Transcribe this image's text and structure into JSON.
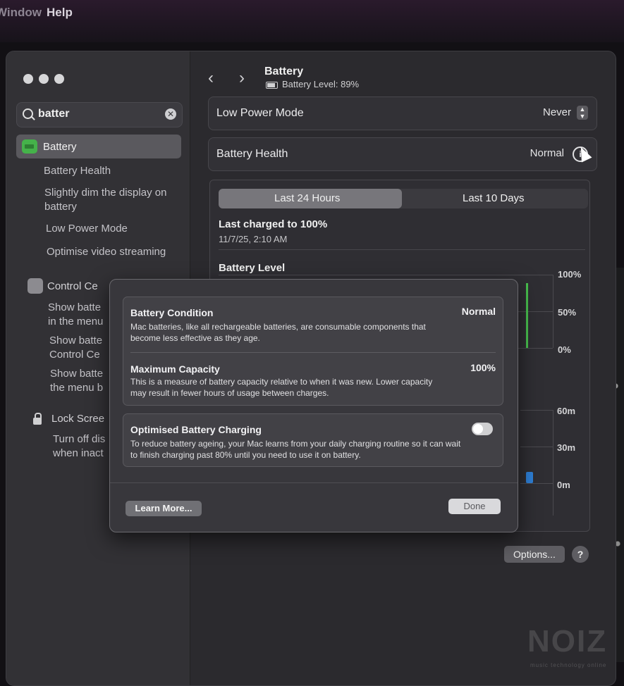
{
  "menubar": {
    "window_label": "Window",
    "help_label": "Help"
  },
  "sidebar": {
    "search_value": "batter",
    "selected_item": "Battery",
    "battery_subitems": [
      "Battery Health",
      "Slightly dim the display on battery",
      "Low Power Mode",
      "Optimise video streaming"
    ],
    "control_centre_label": "Control Ce",
    "control_subitems": [
      "Show batte in the menu",
      "Show batte Control Ce",
      "Show batte the menu b"
    ],
    "lock_screen_label": "Lock Scree",
    "lock_subitems": [
      "Turn off dis when inact"
    ]
  },
  "header": {
    "title": "Battery",
    "subtitle": "Battery Level: 89%"
  },
  "rows": {
    "low_power": {
      "label": "Low Power Mode",
      "value": "Never"
    },
    "health": {
      "label": "Battery Health",
      "value": "Normal"
    }
  },
  "usage": {
    "tab_24h": "Last 24 Hours",
    "tab_10d": "Last 10 Days",
    "selected_tab": "Last 24 Hours",
    "last_charged": "Last charged to 100%",
    "last_charged_date": "11/7/25, 2:10 AM",
    "level_title": "Battery Level",
    "level_axis": [
      "100%",
      "50%",
      "0%"
    ],
    "screen_axis": [
      "60m",
      "30m",
      "0m"
    ]
  },
  "footer": {
    "options_label": "Options...",
    "help_label": "?"
  },
  "sheet": {
    "condition_title": "Battery Condition",
    "condition_value": "Normal",
    "condition_desc": "Mac batteries, like all rechargeable batteries, are consumable components that become less effective as they age.",
    "capacity_title": "Maximum Capacity",
    "capacity_value": "100%",
    "capacity_desc": "This is a measure of battery capacity relative to when it was new. Lower capacity may result in fewer hours of usage between charges.",
    "optimised_title": "Optimised Battery Charging",
    "optimised_desc": "To reduce battery ageing, your Mac learns from your daily charging routine so it can wait to finish charging past 80% until you need to use it on battery.",
    "optimised_on": true,
    "learn_more_label": "Learn More...",
    "done_label": "Done"
  },
  "watermark": {
    "text": "NOIZ",
    "sub": "music technology online"
  },
  "colors": {
    "accent_green": "#49c24f",
    "accent_blue": "#2e7fd6"
  }
}
